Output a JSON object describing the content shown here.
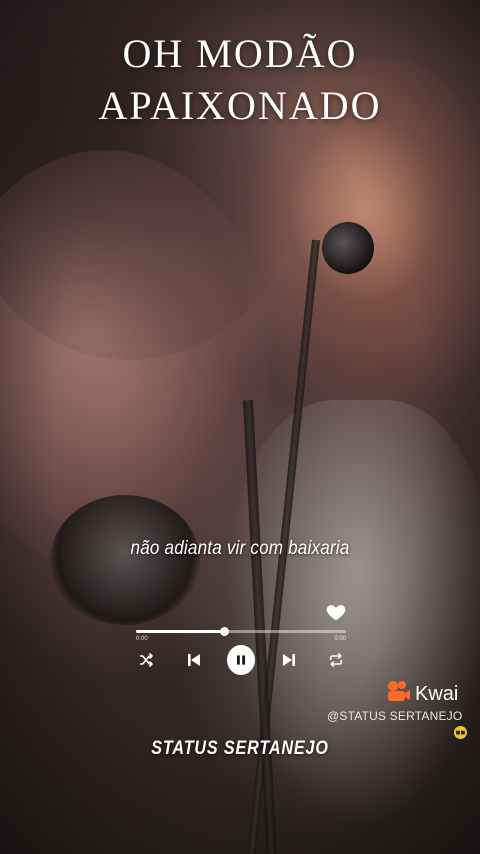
{
  "overlay_title": {
    "line1": "OH MODÃO",
    "line2": "APAIXONADO"
  },
  "lyric": "não adianta vir com baixaria",
  "player": {
    "progress": 0.42,
    "elapsed": "0:00",
    "total": "0:00",
    "liked": true,
    "state": "playing",
    "icons": {
      "like": "heart-icon",
      "shuffle": "shuffle-icon",
      "previous": "skip-previous-icon",
      "play_pause": "pause-icon",
      "next": "skip-next-icon",
      "repeat": "repeat-icon"
    }
  },
  "watermark": {
    "app_name": "Kwai",
    "handle": "@STATUS SERTANEJO",
    "logo_color": "#ff6a2b",
    "emoji": "sunglasses-emoji"
  },
  "channel_name": "STATUS SERTANEJO"
}
